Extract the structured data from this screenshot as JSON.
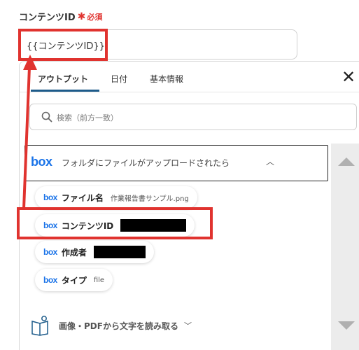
{
  "field": {
    "label": "コンテンツID",
    "required_star": "✱",
    "required_text": "必須",
    "value": "{{コンテンツID}}"
  },
  "panel": {
    "tabs": [
      {
        "label": "アウトプット",
        "active": true
      },
      {
        "label": "日付",
        "active": false
      },
      {
        "label": "基本情報",
        "active": false
      }
    ],
    "close_glyph": "✕",
    "search_placeholder": "検索（前方一致）",
    "section": {
      "logo": "box",
      "title": "フォルダにファイルがアップロードされたら",
      "chevron": "︿"
    },
    "items": [
      {
        "logo": "box",
        "name": "ファイル名",
        "value": "作業報告書サンプル.png"
      },
      {
        "logo": "box",
        "name": "コンテンツID",
        "value": "",
        "redacted": true
      },
      {
        "logo": "box",
        "name": "作成者",
        "value": "",
        "redacted": true
      },
      {
        "logo": "box",
        "name": "タイプ",
        "value": "file"
      }
    ],
    "ocr_section": {
      "icon": "book-ocr-icon",
      "title": "画像・PDFから文字を読み取る",
      "chevron": "﹀"
    }
  },
  "colors": {
    "accent_red": "#e0332f",
    "box_blue": "#1a73e8",
    "tab_underline": "#1d5b8a"
  }
}
